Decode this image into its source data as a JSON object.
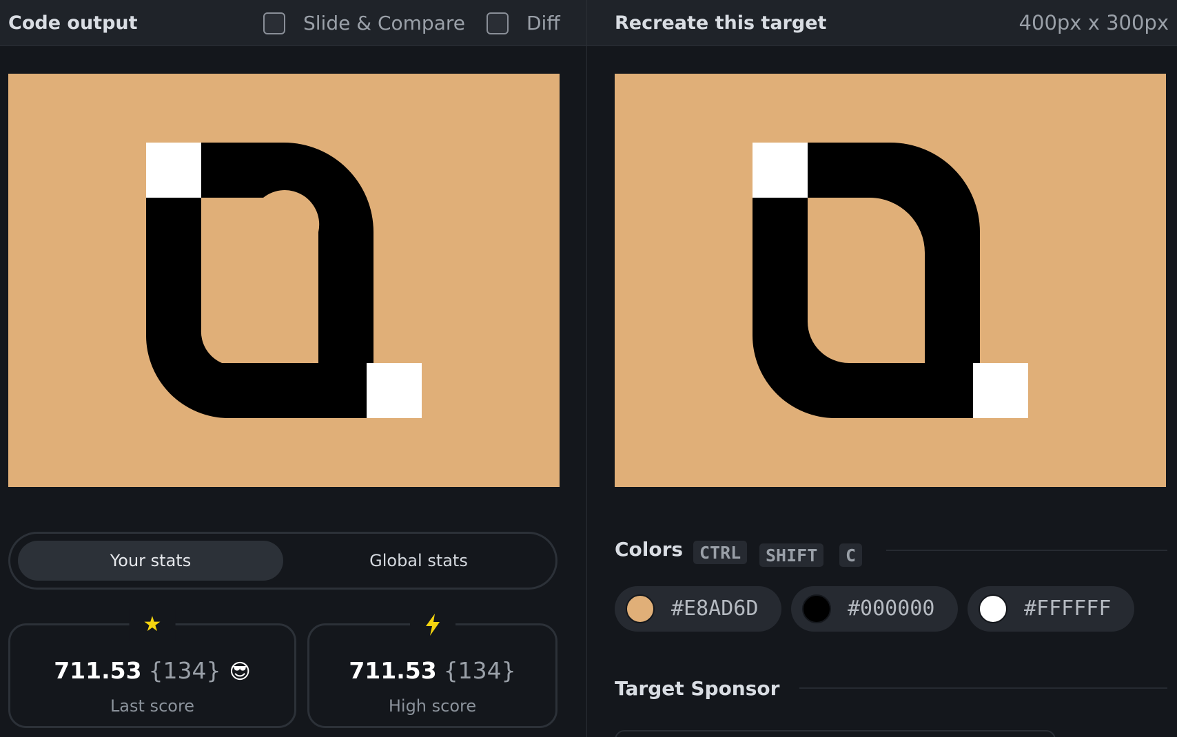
{
  "left": {
    "title": "Code output",
    "slide_compare_label": "Slide & Compare",
    "diff_label": "Diff"
  },
  "right": {
    "title": "Recreate this target",
    "dimensions": "400px x 300px"
  },
  "stats": {
    "your_stats": "Your stats",
    "global_stats": "Global stats",
    "last": {
      "score": "711.53",
      "chars": "{134}",
      "label": "Last score",
      "icon": "star-icon",
      "emoji": "😎"
    },
    "high": {
      "score": "711.53",
      "chars": "{134}",
      "label": "High score",
      "icon": "lightning-icon"
    }
  },
  "colors": {
    "title": "Colors",
    "shortcut": [
      "CTRL",
      "SHIFT",
      "C"
    ],
    "swatches": [
      {
        "hex": "#E8AD6D",
        "color": "#e0af78"
      },
      {
        "hex": "#000000",
        "color": "#000000"
      },
      {
        "hex": "#FFFFFF",
        "color": "#ffffff"
      }
    ]
  },
  "sponsor": {
    "title": "Target Sponsor"
  },
  "target_colors": {
    "background": "#e0af78",
    "shape": "#000000",
    "corner": "#ffffff"
  }
}
